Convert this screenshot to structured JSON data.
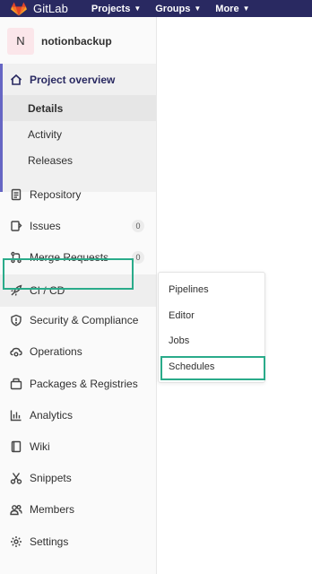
{
  "header": {
    "brand": "GitLab",
    "nav": [
      {
        "label": "Projects",
        "chevron": "chevron-down-icon"
      },
      {
        "label": "Groups",
        "chevron": "chevron-down-icon"
      },
      {
        "label": "More",
        "chevron": "chevron-down-icon"
      }
    ]
  },
  "project": {
    "avatar_letter": "N",
    "name": "notionbackup"
  },
  "sidebar": {
    "overview": {
      "label": "Project overview",
      "icon": "home-icon",
      "subitems": [
        {
          "label": "Details",
          "active": true
        },
        {
          "label": "Activity",
          "active": false
        },
        {
          "label": "Releases",
          "active": false
        }
      ]
    },
    "items": [
      {
        "label": "Repository",
        "icon": "document-icon"
      },
      {
        "label": "Issues",
        "icon": "issues-icon",
        "badge": "0"
      },
      {
        "label": "Merge Requests",
        "icon": "merge-request-icon",
        "badge": "0"
      },
      {
        "label": "CI / CD",
        "icon": "rocket-icon"
      },
      {
        "label": "Security & Compliance",
        "icon": "shield-icon"
      },
      {
        "label": "Operations",
        "icon": "cloud-gear-icon"
      },
      {
        "label": "Packages & Registries",
        "icon": "package-icon"
      },
      {
        "label": "Analytics",
        "icon": "chart-icon"
      },
      {
        "label": "Wiki",
        "icon": "book-icon"
      },
      {
        "label": "Snippets",
        "icon": "scissors-icon"
      },
      {
        "label": "Members",
        "icon": "users-icon"
      },
      {
        "label": "Settings",
        "icon": "gear-icon"
      }
    ]
  },
  "cicd_flyout": {
    "items": [
      "Pipelines",
      "Editor",
      "Jobs",
      "Schedules"
    ]
  },
  "colors": {
    "topbar": "#292961",
    "overview_accent": "#6666c4",
    "highlight": "#2aab8a",
    "logo": "#e24329"
  }
}
